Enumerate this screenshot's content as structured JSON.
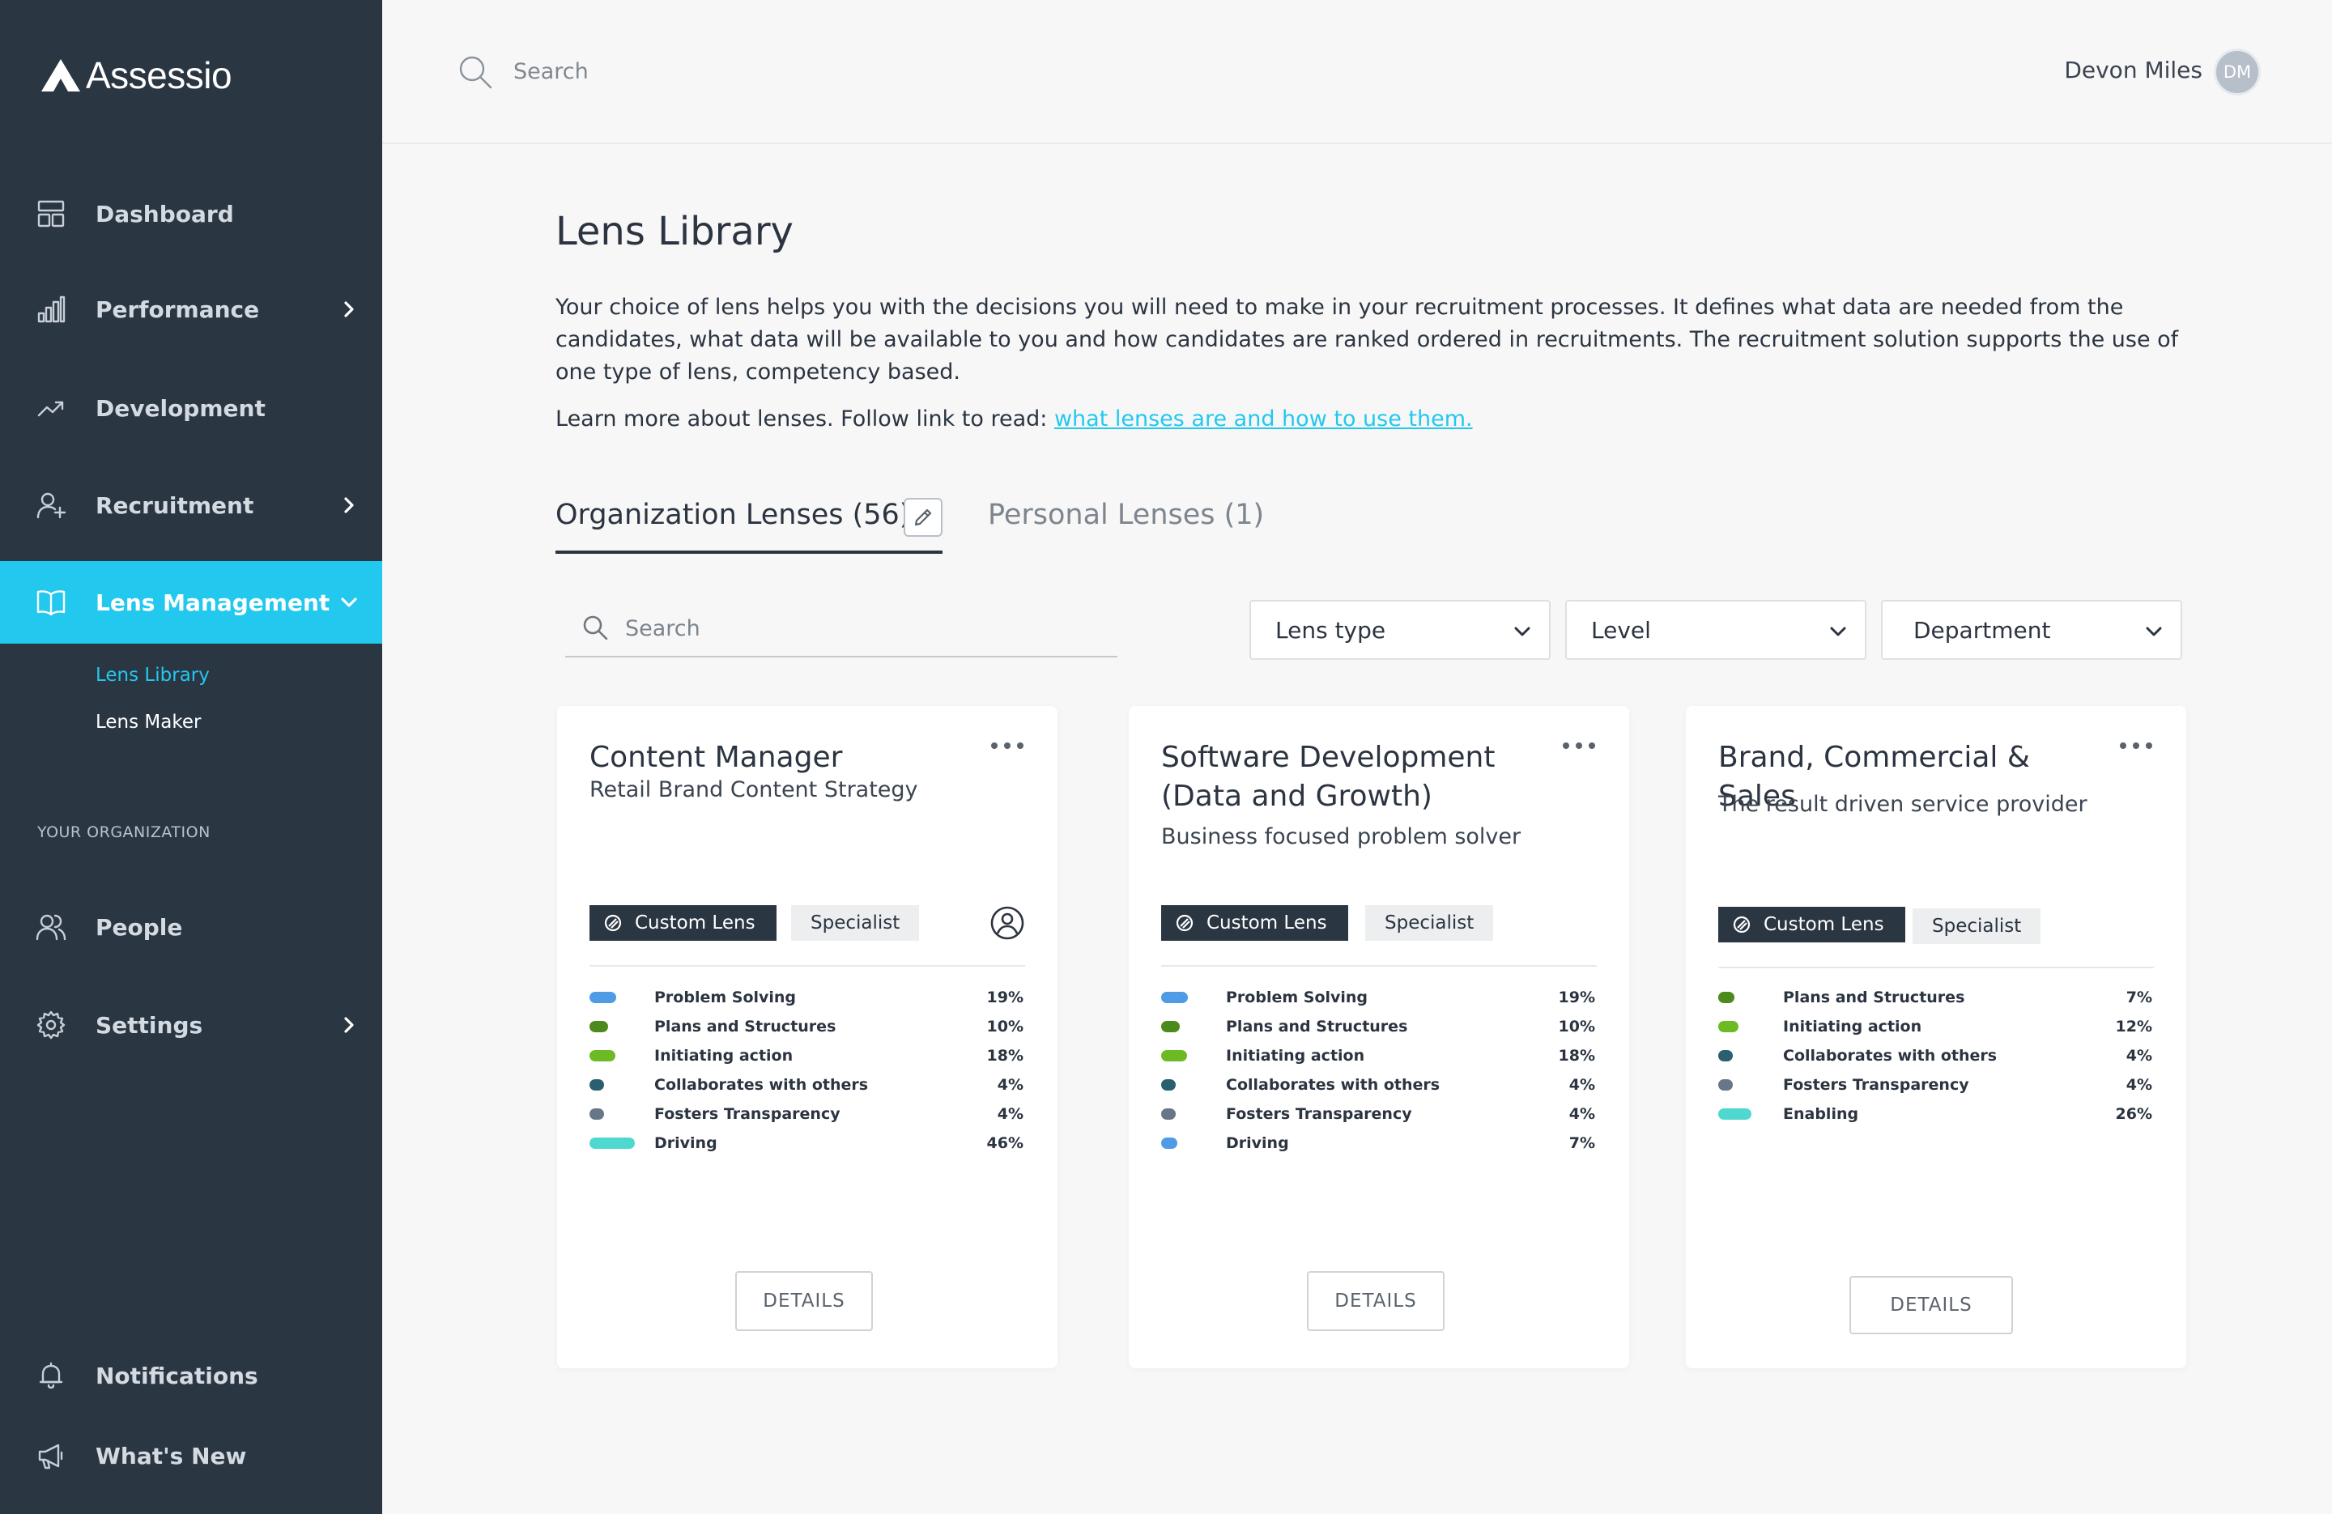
{
  "app": {
    "name": "Assessio"
  },
  "sidebar": {
    "items": [
      {
        "label": "Dashboard",
        "icon": "dashboard-icon"
      },
      {
        "label": "Performance",
        "icon": "bar-chart-icon"
      },
      {
        "label": "Development",
        "icon": "trend-icon"
      },
      {
        "label": "Recruitment",
        "icon": "add-user-icon"
      },
      {
        "label": "Lens Management",
        "icon": "book-icon"
      }
    ],
    "sub_items": [
      {
        "label": "Lens Library",
        "active": true
      },
      {
        "label": "Lens Maker",
        "active": false
      }
    ],
    "section_label": "YOUR ORGANIZATION",
    "org_items": [
      {
        "label": "People",
        "icon": "people-icon"
      },
      {
        "label": "Settings",
        "icon": "gear-icon"
      }
    ],
    "bottom_items": [
      {
        "label": "Notifications",
        "icon": "bell-icon"
      },
      {
        "label": "What's New",
        "icon": "megaphone-icon"
      }
    ]
  },
  "header": {
    "search_placeholder": "Search",
    "user_name": "Devon Miles",
    "user_initials": "DM"
  },
  "main": {
    "title": "Lens Library",
    "intro": "Your choice of lens helps you with the decisions you will need to make in your recruitment processes. It defines what data are needed from the candidates, what data will be available to you and how candidates are ranked ordered in recruitments. The recruitment solution supports the use of one type of lens, competency based.",
    "learn_text": "Learn more about lenses. Follow link to read: ",
    "learn_link": "what lenses are and how to use them.",
    "tabs": [
      {
        "label": "Organization Lenses (56)",
        "active": true
      },
      {
        "label": "Personal Lenses (1)",
        "active": false
      }
    ],
    "list_search_placeholder": "Search",
    "filters": [
      {
        "label": "Lens type"
      },
      {
        "label": "Level"
      },
      {
        "label": "Department"
      }
    ],
    "details_label": "DETAILS"
  },
  "colors": {
    "sidebar_bg": "#2b3643",
    "accent": "#23c8ee",
    "problem_solving": "#4f9be6",
    "plans_and_structures": "#4d8a1e",
    "initiating_action": "#6cbb24",
    "collaborates_with_others": "#2a5f6f",
    "fosters_transparency": "#677788",
    "driving": "#4fd8d0",
    "driving_alt": "#4f9be6",
    "enabling": "#4fd8d0"
  },
  "cards": [
    {
      "title": "Content Manager",
      "subtitle": "Retail Brand Content Strategy",
      "tag": "Custom Lens",
      "level": "Specialist",
      "owner_icon": "user-circle-icon",
      "competencies": [
        {
          "name": "Problem Solving",
          "pct": "19%",
          "color": "#4f9be6",
          "value": 19
        },
        {
          "name": "Plans and Structures",
          "pct": "10%",
          "color": "#4d8a1e",
          "value": 10
        },
        {
          "name": "Initiating action",
          "pct": "18%",
          "color": "#6cbb24",
          "value": 18
        },
        {
          "name": "Collaborates with others",
          "pct": "4%",
          "color": "#2a5f6f",
          "value": 4
        },
        {
          "name": "Fosters Transparency",
          "pct": "4%",
          "color": "#677788",
          "value": 4
        },
        {
          "name": "Driving",
          "pct": "46%",
          "color": "#4fd8d0",
          "value": 46
        }
      ]
    },
    {
      "title": "Software Development (Data and Growth)",
      "subtitle": "Business focused problem solver",
      "tag": "Custom Lens",
      "level": "Specialist",
      "competencies": [
        {
          "name": "Problem Solving",
          "pct": "19%",
          "color": "#4f9be6",
          "value": 19
        },
        {
          "name": "Plans and Structures",
          "pct": "10%",
          "color": "#4d8a1e",
          "value": 10
        },
        {
          "name": "Initiating action",
          "pct": "18%",
          "color": "#6cbb24",
          "value": 18
        },
        {
          "name": "Collaborates with others",
          "pct": "4%",
          "color": "#2a5f6f",
          "value": 4
        },
        {
          "name": "Fosters Transparency",
          "pct": "4%",
          "color": "#677788",
          "value": 4
        },
        {
          "name": "Driving",
          "pct": "7%",
          "color": "#4f9be6",
          "value": 7
        }
      ]
    },
    {
      "title": "Brand, Commercial & Sales",
      "subtitle": "The result driven service provider",
      "tag": "Custom Lens",
      "level": "Specialist",
      "competencies": [
        {
          "name": "Plans and Structures",
          "pct": "7%",
          "color": "#4d8a1e",
          "value": 7
        },
        {
          "name": "Initiating action",
          "pct": "12%",
          "color": "#6cbb24",
          "value": 12
        },
        {
          "name": "Collaborates with others",
          "pct": "4%",
          "color": "#2a5f6f",
          "value": 4
        },
        {
          "name": "Fosters Transparency",
          "pct": "4%",
          "color": "#677788",
          "value": 4
        },
        {
          "name": "Enabling",
          "pct": "26%",
          "color": "#4fd8d0",
          "value": 26
        }
      ]
    }
  ]
}
